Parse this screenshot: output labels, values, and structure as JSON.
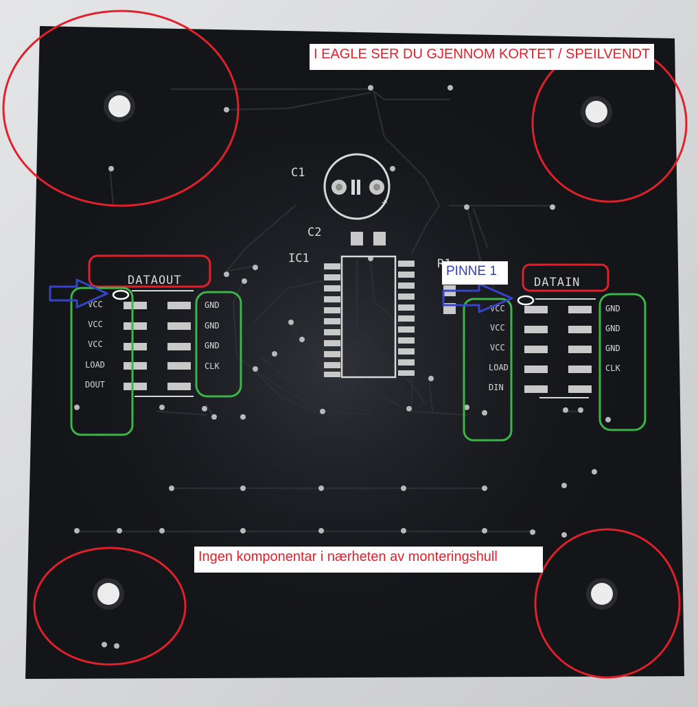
{
  "annotations": {
    "top_note": "I EAGLE SER DU  GJENNOM KORTET / SPEILVENDT",
    "pin1_note": "PINNE 1",
    "bottom_note": "Ingen komponentar i nærheten av monteringshull"
  },
  "silkscreen": {
    "c1": "C1",
    "c2": "C2",
    "ic1": "IC1",
    "r1": "R1",
    "dataout": "DATAOUT",
    "datain": "DATAIN",
    "out_left_pins": [
      "VCC",
      "VCC",
      "VCC",
      "LOAD",
      "DOUT"
    ],
    "out_right_pins": [
      "GND",
      "GND",
      "GND",
      "CLK"
    ],
    "in_left_pins": [
      "VCC",
      "VCC",
      "VCC",
      "LOAD",
      "DIN"
    ],
    "in_right_pins": [
      "GND",
      "GND",
      "GND",
      "CLK"
    ]
  },
  "colors": {
    "board": "#141519",
    "silk": "#d8d8d8",
    "pad": "#c9c9c9",
    "mark_red": "#e0202a",
    "mark_green": "#3cb648",
    "arrow_blue": "#3445c8"
  }
}
